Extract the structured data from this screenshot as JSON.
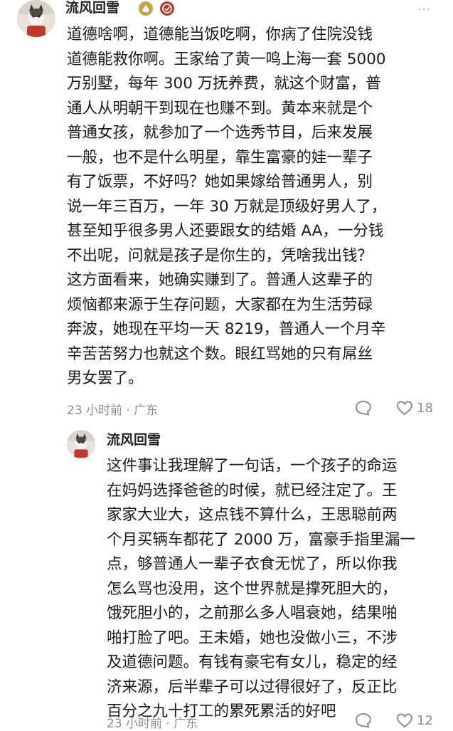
{
  "top_comment": {
    "username": "流风回雪",
    "more_label": "···",
    "lines": [
      "道德啥啊，道德能当饭吃啊，你病了住院没钱",
      "道德能救你啊。王家给了黄一鸣上海一套 5000",
      "万别墅，每年 300 万抚养费，就这个财富，普",
      "通人从明朝干到现在也赚不到。黄本来就是个",
      "普通女孩，就参加了一个选秀节目，后来发展",
      "一般，也不是什么明星，靠生富豪的娃一辈子",
      "有了饭票，不好吗？她如果嫁给普通男人，别",
      "说一年三百万，一年 30 万就是顶级好男人了，",
      "甚至知乎很多男人还要跟女的结婚 AA，一分钱",
      "不出呢，问就是孩子是你生的，凭啥我出钱？",
      "这方面看来，她确实赚到了。普通人这辈子的",
      "烦恼都来源于生存问题，大家都在为生活劳碌",
      "奔波，她现在平均一天 8219，普通人一个月辛",
      "辛苦苦努力也就这个数。眼红骂她的只有屌丝",
      "男女罢了。"
    ],
    "meta": "23 小时前 · 广东",
    "like_count": "18"
  },
  "reply": {
    "username": "流风回雪",
    "lines": [
      "这件事让我理解了一句话，一个孩子的命运",
      "在妈妈选择爸爸的时候，就已经注定了。王",
      "家家大业大，这点钱不算什么，王思聪前两",
      "个月买辆车都花了 2000 万，富豪手指里漏一",
      "点，够普通人一辈子衣食无忧了，所以你我",
      "怎么骂也没用，这个世界就是撑死胆大的，",
      "饿死胆小的，之前那么多人唱衰她，结果啪",
      "啪打脸了吧。王未婚，她也没做小三，不涉",
      "及道德问题。有钱有豪宅有女儿，稳定的经",
      "济来源，后半辈子可以过得很好了，反正比",
      "百分之九十打工的累死累活的好吧"
    ],
    "meta": "23 小时前 · 广东",
    "like_count": "12"
  },
  "colors": {
    "badge_gold": "#c9a24a",
    "badge_red": "#c0392b",
    "meta_gray": "#8d8d8d"
  }
}
